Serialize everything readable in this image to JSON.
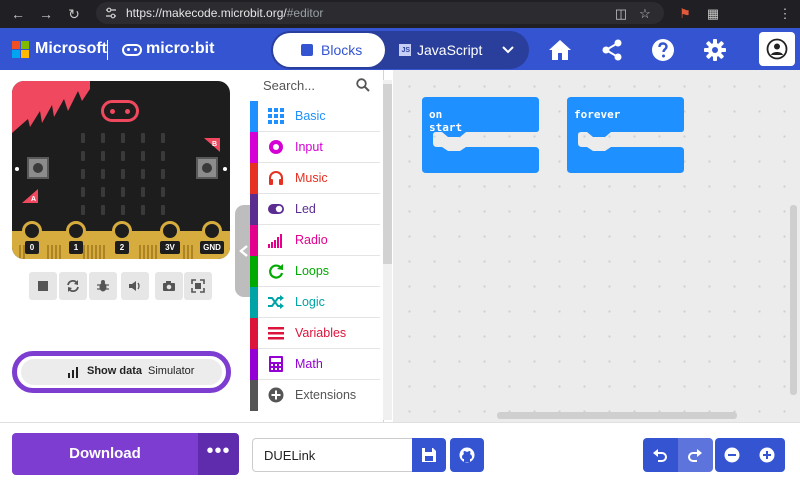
{
  "browser": {
    "url_host": "https://makecode.microbit.org/",
    "url_path": "#editor"
  },
  "header": {
    "brand": "Microsoft",
    "product": "micro:bit",
    "mode_blocks": "Blocks",
    "mode_js": "JavaScript",
    "js_badge": "JS"
  },
  "simulator": {
    "pins": [
      "0",
      "1",
      "2",
      "3V",
      "GND"
    ],
    "button_a": "A",
    "button_b": "B",
    "show_data_label": "Show data",
    "show_data_sub": "Simulator"
  },
  "toolbox": {
    "search_placeholder": "Search...",
    "categories": [
      {
        "label": "Basic",
        "color": "#1e90ff",
        "icon": "grid-icon"
      },
      {
        "label": "Input",
        "color": "#d400d4",
        "icon": "circle-dot-icon"
      },
      {
        "label": "Music",
        "color": "#e63022",
        "icon": "headphones-icon"
      },
      {
        "label": "Led",
        "color": "#5c2d91",
        "icon": "toggle-icon"
      },
      {
        "label": "Radio",
        "color": "#e3008c",
        "icon": "signal-bars-icon"
      },
      {
        "label": "Loops",
        "color": "#00aa00",
        "icon": "refresh-icon"
      },
      {
        "label": "Logic",
        "color": "#00a4a6",
        "icon": "shuffle-icon"
      },
      {
        "label": "Variables",
        "color": "#dc143c",
        "icon": "list-lines-icon"
      },
      {
        "label": "Math",
        "color": "#9400d3",
        "icon": "calculator-icon"
      },
      {
        "label": "Extensions",
        "color": "#555555",
        "icon": "plus-circle-icon"
      }
    ]
  },
  "workspace": {
    "blocks": [
      "on start",
      "forever"
    ],
    "block_color": "#1e90ff"
  },
  "footer": {
    "download_label": "Download",
    "more_label": "•••",
    "project_name": "DUELink"
  }
}
